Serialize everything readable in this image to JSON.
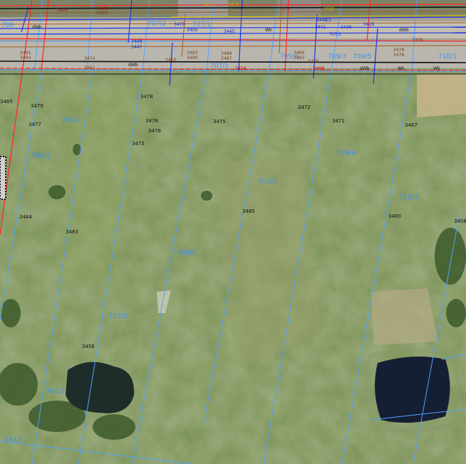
{
  "map": {
    "parcels_top": [
      "708",
      "707/2",
      "707/1",
      "707/1",
      "709/4",
      "709/3",
      "709/5",
      "710/1"
    ],
    "parcels_main": [
      "707/2",
      "709/2",
      "709/1",
      "708/2",
      "709/6",
      "710/2",
      "707/2",
      "706/2",
      "1613"
    ],
    "point_numbers": [
      "3478",
      "3479",
      "3477",
      "3478",
      "3476",
      "3475",
      "3475",
      "3472",
      "3471",
      "3467",
      "3485",
      "3484",
      "3483",
      "3480",
      "3458",
      "3456",
      "3465"
    ],
    "road_labels": [
      "dWb",
      "dWb",
      "Wb",
      "Wb",
      "dWb",
      "Wb",
      "dWb"
    ],
    "strip_labels_red": [
      "3416",
      "3490",
      "3488",
      "3434"
    ],
    "strip_labels_brown": [
      "3438",
      "3461",
      "3494",
      "3493",
      "3490",
      "3488",
      "3487",
      "3486",
      "3483",
      "3479",
      "3478",
      "3474",
      "3462",
      "3460",
      "3458",
      "3456",
      "3452"
    ],
    "strip_labels_blue": [
      "3470",
      "3456",
      "3448",
      "3447",
      "3445",
      "3441",
      "3436",
      "3426",
      "3448/1",
      "707/1"
    ],
    "strip_labels_yellow": [
      "3479",
      "3476",
      "3430"
    ],
    "legend_colors": {
      "parcel_boundary": "#4fa3ff",
      "property_line": "#ff2a2a",
      "utility_line": "#1a35e8",
      "cable_line": "#a45a1c",
      "road_edge": "#111111"
    }
  }
}
